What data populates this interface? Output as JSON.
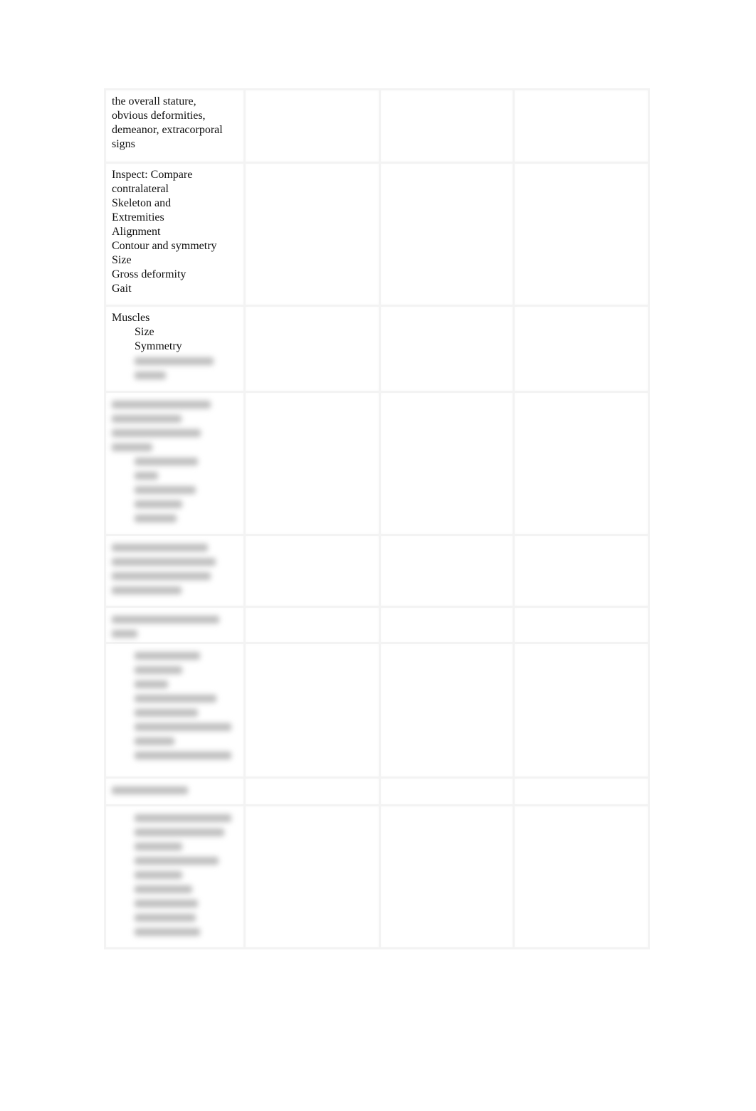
{
  "document": {
    "rows": [
      {
        "lines": [
          {
            "text": "the overall stature,",
            "indent": false
          },
          {
            "text": "obvious deformities,",
            "indent": false
          },
          {
            "text": "demeanor, extracorporal",
            "indent": false
          },
          {
            "text": "signs",
            "indent": false
          }
        ],
        "blurred_lines": []
      },
      {
        "lines": [
          {
            "text": "Inspect:  Compare",
            "indent": false
          },
          {
            "text": "contralateral",
            "indent": false
          },
          {
            "text": "Skeleton and",
            "indent": false
          },
          {
            "text": "Extremities",
            "indent": false
          },
          {
            "text": "Alignment",
            "indent": false
          },
          {
            "text": "Contour and symmetry",
            "indent": false
          },
          {
            "text": "Size",
            "indent": false
          },
          {
            "text": "Gross deformity",
            "indent": false
          },
          {
            "text": "Gait",
            "indent": false
          }
        ],
        "blurred_lines": []
      },
      {
        "lines": [
          {
            "text": "Muscles",
            "indent": false
          },
          {
            "text": "Size",
            "indent": true
          },
          {
            "text": "Symmetry",
            "indent": true
          }
        ],
        "blurred_lines": [
          {
            "indent": true,
            "widths": [
              0.75
            ]
          },
          {
            "indent": true,
            "widths": [
              0.3
            ]
          }
        ]
      },
      {
        "lines": [],
        "blurred_lines": [
          {
            "indent": false,
            "widths": [
              0.78
            ]
          },
          {
            "indent": false,
            "widths": [
              0.55
            ]
          },
          {
            "indent": false,
            "widths": [
              0.7
            ]
          },
          {
            "indent": false,
            "widths": [
              0.32
            ]
          },
          {
            "indent": true,
            "widths": [
              0.6
            ]
          },
          {
            "indent": true,
            "widths": [
              0.22
            ]
          },
          {
            "indent": true,
            "widths": [
              0.58
            ]
          },
          {
            "indent": true,
            "widths": [
              0.45
            ]
          },
          {
            "indent": true,
            "widths": [
              0.4
            ]
          }
        ]
      },
      {
        "lines": [],
        "blurred_lines": [
          {
            "indent": false,
            "widths": [
              0.76
            ]
          },
          {
            "indent": false,
            "widths": [
              0.82
            ]
          },
          {
            "indent": false,
            "widths": [
              0.78
            ]
          },
          {
            "indent": false,
            "widths": [
              0.55
            ]
          }
        ]
      },
      {
        "lines": [],
        "blurred_lines": [
          {
            "indent": false,
            "widths": [
              0.85
            ]
          },
          {
            "indent": false,
            "widths": [
              0.2
            ]
          }
        ]
      },
      {
        "lines": [],
        "blurred_lines": [
          {
            "indent": true,
            "widths": [
              0.62
            ]
          },
          {
            "indent": true,
            "widths": [
              0.45
            ]
          },
          {
            "indent": true,
            "widths": [
              0.32
            ]
          },
          {
            "indent": true,
            "widths": [
              0.78
            ]
          },
          {
            "indent": true,
            "widths": [
              0.6
            ]
          },
          {
            "indent": true,
            "widths": [
              0.92
            ]
          },
          {
            "indent": true,
            "widths": [
              0.38
            ]
          },
          {
            "indent": true,
            "widths": [
              0.92
            ]
          }
        ]
      },
      {
        "lines": [],
        "blurred_lines": [
          {
            "indent": false,
            "widths": [
              0.6
            ]
          }
        ]
      },
      {
        "lines": [],
        "blurred_lines": [
          {
            "indent": true,
            "widths": [
              0.92
            ]
          },
          {
            "indent": true,
            "widths": [
              0.85
            ]
          },
          {
            "indent": true,
            "widths": [
              0.45
            ]
          },
          {
            "indent": true,
            "widths": [
              0.8
            ]
          },
          {
            "indent": true,
            "widths": [
              0.45
            ]
          },
          {
            "indent": true,
            "widths": [
              0.55
            ]
          },
          {
            "indent": true,
            "widths": [
              0.6
            ]
          },
          {
            "indent": true,
            "widths": [
              0.58
            ]
          },
          {
            "indent": true,
            "widths": [
              0.62
            ]
          }
        ]
      }
    ],
    "empty_columns": 3
  }
}
